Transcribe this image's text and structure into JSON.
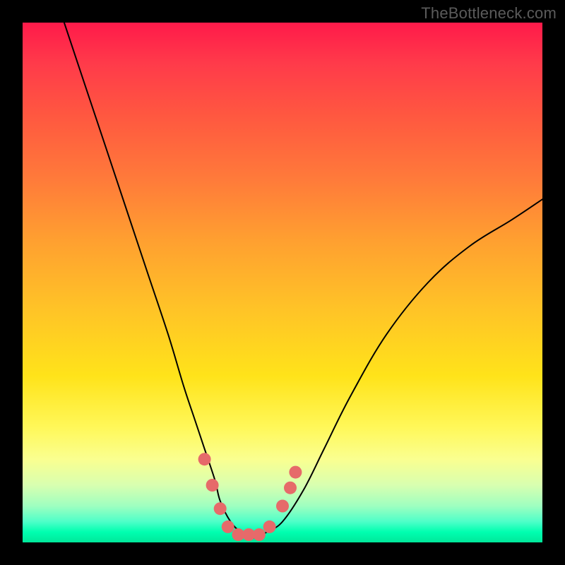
{
  "watermark": "TheBottleneck.com",
  "chart_data": {
    "type": "line",
    "title": "",
    "xlabel": "",
    "ylabel": "",
    "xlim": [
      0,
      100
    ],
    "ylim": [
      0,
      100
    ],
    "series": [
      {
        "name": "curve",
        "x": [
          8,
          12,
          16,
          20,
          24,
          28,
          31,
          33,
          35,
          37,
          38,
          40,
          42,
          44,
          45,
          47,
          50,
          54,
          58,
          63,
          70,
          78,
          86,
          94,
          100
        ],
        "y": [
          100,
          88,
          76,
          64,
          52,
          40,
          30,
          24,
          18,
          12,
          8,
          4,
          2,
          1,
          1,
          2,
          4,
          10,
          18,
          28,
          40,
          50,
          57,
          62,
          66
        ]
      }
    ],
    "markers": {
      "name": "highlight-dots",
      "color": "#e66a6a",
      "points": [
        {
          "x": 35.0,
          "y": 16.0
        },
        {
          "x": 36.5,
          "y": 11.0
        },
        {
          "x": 38.0,
          "y": 6.5
        },
        {
          "x": 39.5,
          "y": 3.0
        },
        {
          "x": 41.5,
          "y": 1.5
        },
        {
          "x": 43.5,
          "y": 1.5
        },
        {
          "x": 45.5,
          "y": 1.5
        },
        {
          "x": 47.5,
          "y": 3.0
        },
        {
          "x": 50.0,
          "y": 7.0
        },
        {
          "x": 51.5,
          "y": 10.5
        },
        {
          "x": 52.5,
          "y": 13.5
        }
      ]
    }
  }
}
